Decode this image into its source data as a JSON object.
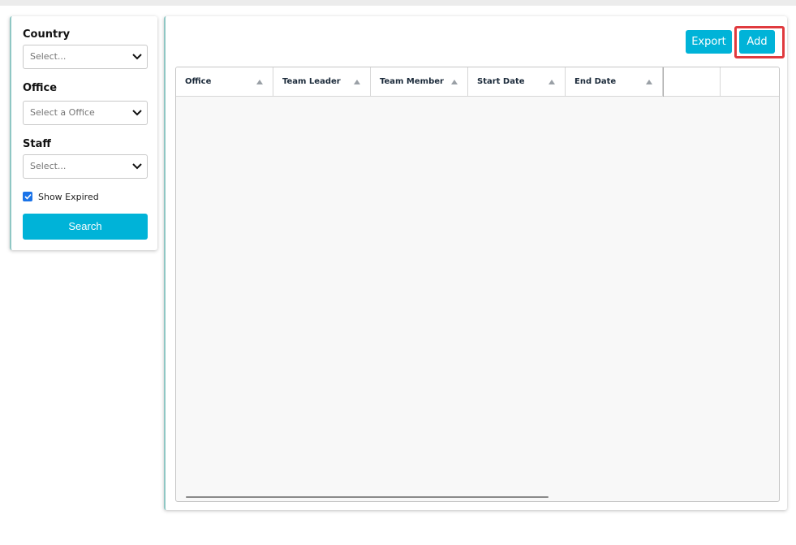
{
  "filters": {
    "country": {
      "label": "Country",
      "placeholder": "Select..."
    },
    "office": {
      "label": "Office",
      "placeholder": "Select a Office"
    },
    "staff": {
      "label": "Staff",
      "placeholder": "Select..."
    },
    "show_expired": {
      "label": "Show Expired",
      "checked": true
    },
    "search_label": "Search"
  },
  "toolbar": {
    "export_label": "Export",
    "add_label": "Add"
  },
  "grid": {
    "columns": [
      "Office",
      "Team Leader",
      "Team Member",
      "Start Date",
      "End Date",
      "",
      ""
    ],
    "rows": []
  },
  "colors": {
    "accent": "#00b3d8",
    "highlight": "#e03a3e",
    "checkbox": "#1a73e8"
  }
}
